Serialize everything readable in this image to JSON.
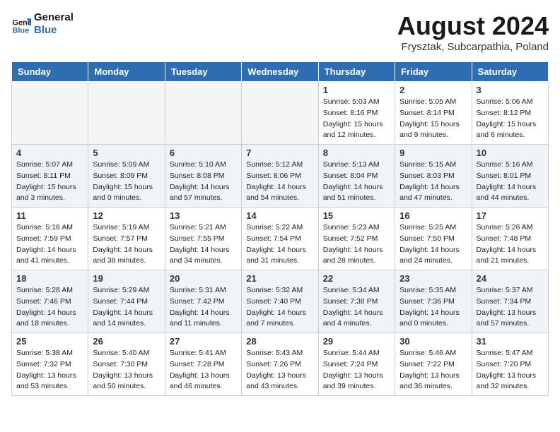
{
  "header": {
    "logo_line1": "General",
    "logo_line2": "Blue",
    "month": "August 2024",
    "location": "Frysztak, Subcarpathia, Poland"
  },
  "weekdays": [
    "Sunday",
    "Monday",
    "Tuesday",
    "Wednesday",
    "Thursday",
    "Friday",
    "Saturday"
  ],
  "weeks": [
    [
      {
        "day": "",
        "info": ""
      },
      {
        "day": "",
        "info": ""
      },
      {
        "day": "",
        "info": ""
      },
      {
        "day": "",
        "info": ""
      },
      {
        "day": "1",
        "info": "Sunrise: 5:03 AM\nSunset: 8:16 PM\nDaylight: 15 hours\nand 12 minutes."
      },
      {
        "day": "2",
        "info": "Sunrise: 5:05 AM\nSunset: 8:14 PM\nDaylight: 15 hours\nand 9 minutes."
      },
      {
        "day": "3",
        "info": "Sunrise: 5:06 AM\nSunset: 8:12 PM\nDaylight: 15 hours\nand 6 minutes."
      }
    ],
    [
      {
        "day": "4",
        "info": "Sunrise: 5:07 AM\nSunset: 8:11 PM\nDaylight: 15 hours\nand 3 minutes."
      },
      {
        "day": "5",
        "info": "Sunrise: 5:09 AM\nSunset: 8:09 PM\nDaylight: 15 hours\nand 0 minutes."
      },
      {
        "day": "6",
        "info": "Sunrise: 5:10 AM\nSunset: 8:08 PM\nDaylight: 14 hours\nand 57 minutes."
      },
      {
        "day": "7",
        "info": "Sunrise: 5:12 AM\nSunset: 8:06 PM\nDaylight: 14 hours\nand 54 minutes."
      },
      {
        "day": "8",
        "info": "Sunrise: 5:13 AM\nSunset: 8:04 PM\nDaylight: 14 hours\nand 51 minutes."
      },
      {
        "day": "9",
        "info": "Sunrise: 5:15 AM\nSunset: 8:03 PM\nDaylight: 14 hours\nand 47 minutes."
      },
      {
        "day": "10",
        "info": "Sunrise: 5:16 AM\nSunset: 8:01 PM\nDaylight: 14 hours\nand 44 minutes."
      }
    ],
    [
      {
        "day": "11",
        "info": "Sunrise: 5:18 AM\nSunset: 7:59 PM\nDaylight: 14 hours\nand 41 minutes."
      },
      {
        "day": "12",
        "info": "Sunrise: 5:19 AM\nSunset: 7:57 PM\nDaylight: 14 hours\nand 38 minutes."
      },
      {
        "day": "13",
        "info": "Sunrise: 5:21 AM\nSunset: 7:55 PM\nDaylight: 14 hours\nand 34 minutes."
      },
      {
        "day": "14",
        "info": "Sunrise: 5:22 AM\nSunset: 7:54 PM\nDaylight: 14 hours\nand 31 minutes."
      },
      {
        "day": "15",
        "info": "Sunrise: 5:23 AM\nSunset: 7:52 PM\nDaylight: 14 hours\nand 28 minutes."
      },
      {
        "day": "16",
        "info": "Sunrise: 5:25 AM\nSunset: 7:50 PM\nDaylight: 14 hours\nand 24 minutes."
      },
      {
        "day": "17",
        "info": "Sunrise: 5:26 AM\nSunset: 7:48 PM\nDaylight: 14 hours\nand 21 minutes."
      }
    ],
    [
      {
        "day": "18",
        "info": "Sunrise: 5:28 AM\nSunset: 7:46 PM\nDaylight: 14 hours\nand 18 minutes."
      },
      {
        "day": "19",
        "info": "Sunrise: 5:29 AM\nSunset: 7:44 PM\nDaylight: 14 hours\nand 14 minutes."
      },
      {
        "day": "20",
        "info": "Sunrise: 5:31 AM\nSunset: 7:42 PM\nDaylight: 14 hours\nand 11 minutes."
      },
      {
        "day": "21",
        "info": "Sunrise: 5:32 AM\nSunset: 7:40 PM\nDaylight: 14 hours\nand 7 minutes."
      },
      {
        "day": "22",
        "info": "Sunrise: 5:34 AM\nSunset: 7:38 PM\nDaylight: 14 hours\nand 4 minutes."
      },
      {
        "day": "23",
        "info": "Sunrise: 5:35 AM\nSunset: 7:36 PM\nDaylight: 14 hours\nand 0 minutes."
      },
      {
        "day": "24",
        "info": "Sunrise: 5:37 AM\nSunset: 7:34 PM\nDaylight: 13 hours\nand 57 minutes."
      }
    ],
    [
      {
        "day": "25",
        "info": "Sunrise: 5:38 AM\nSunset: 7:32 PM\nDaylight: 13 hours\nand 53 minutes."
      },
      {
        "day": "26",
        "info": "Sunrise: 5:40 AM\nSunset: 7:30 PM\nDaylight: 13 hours\nand 50 minutes."
      },
      {
        "day": "27",
        "info": "Sunrise: 5:41 AM\nSunset: 7:28 PM\nDaylight: 13 hours\nand 46 minutes."
      },
      {
        "day": "28",
        "info": "Sunrise: 5:43 AM\nSunset: 7:26 PM\nDaylight: 13 hours\nand 43 minutes."
      },
      {
        "day": "29",
        "info": "Sunrise: 5:44 AM\nSunset: 7:24 PM\nDaylight: 13 hours\nand 39 minutes."
      },
      {
        "day": "30",
        "info": "Sunrise: 5:46 AM\nSunset: 7:22 PM\nDaylight: 13 hours\nand 36 minutes."
      },
      {
        "day": "31",
        "info": "Sunrise: 5:47 AM\nSunset: 7:20 PM\nDaylight: 13 hours\nand 32 minutes."
      }
    ]
  ]
}
